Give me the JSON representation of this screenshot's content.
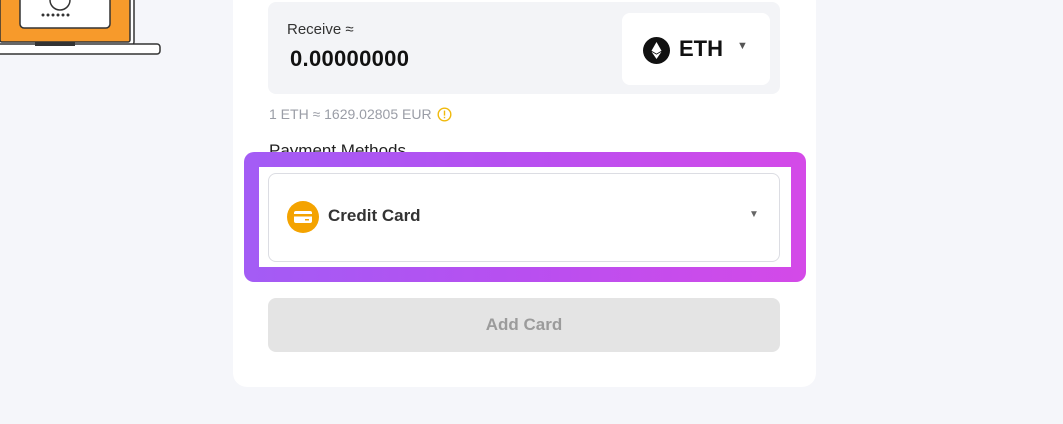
{
  "receive": {
    "label": "Receive ≈",
    "amount": "0.00000000",
    "coin": {
      "label": "ETH",
      "icon": "ethereum-icon"
    }
  },
  "rate": {
    "text": "1 ETH ≈ 1629.02805 EUR",
    "icon": "info-warning-icon"
  },
  "payment": {
    "label": "Payment Methods",
    "selected": {
      "label": "Credit Card",
      "icon": "credit-card-icon"
    }
  },
  "actions": {
    "add_card_label": "Add Card"
  },
  "colors": {
    "accent_highlight": "#b84ff0",
    "card_icon": "#f4a300",
    "info_icon": "#f0b90b"
  }
}
